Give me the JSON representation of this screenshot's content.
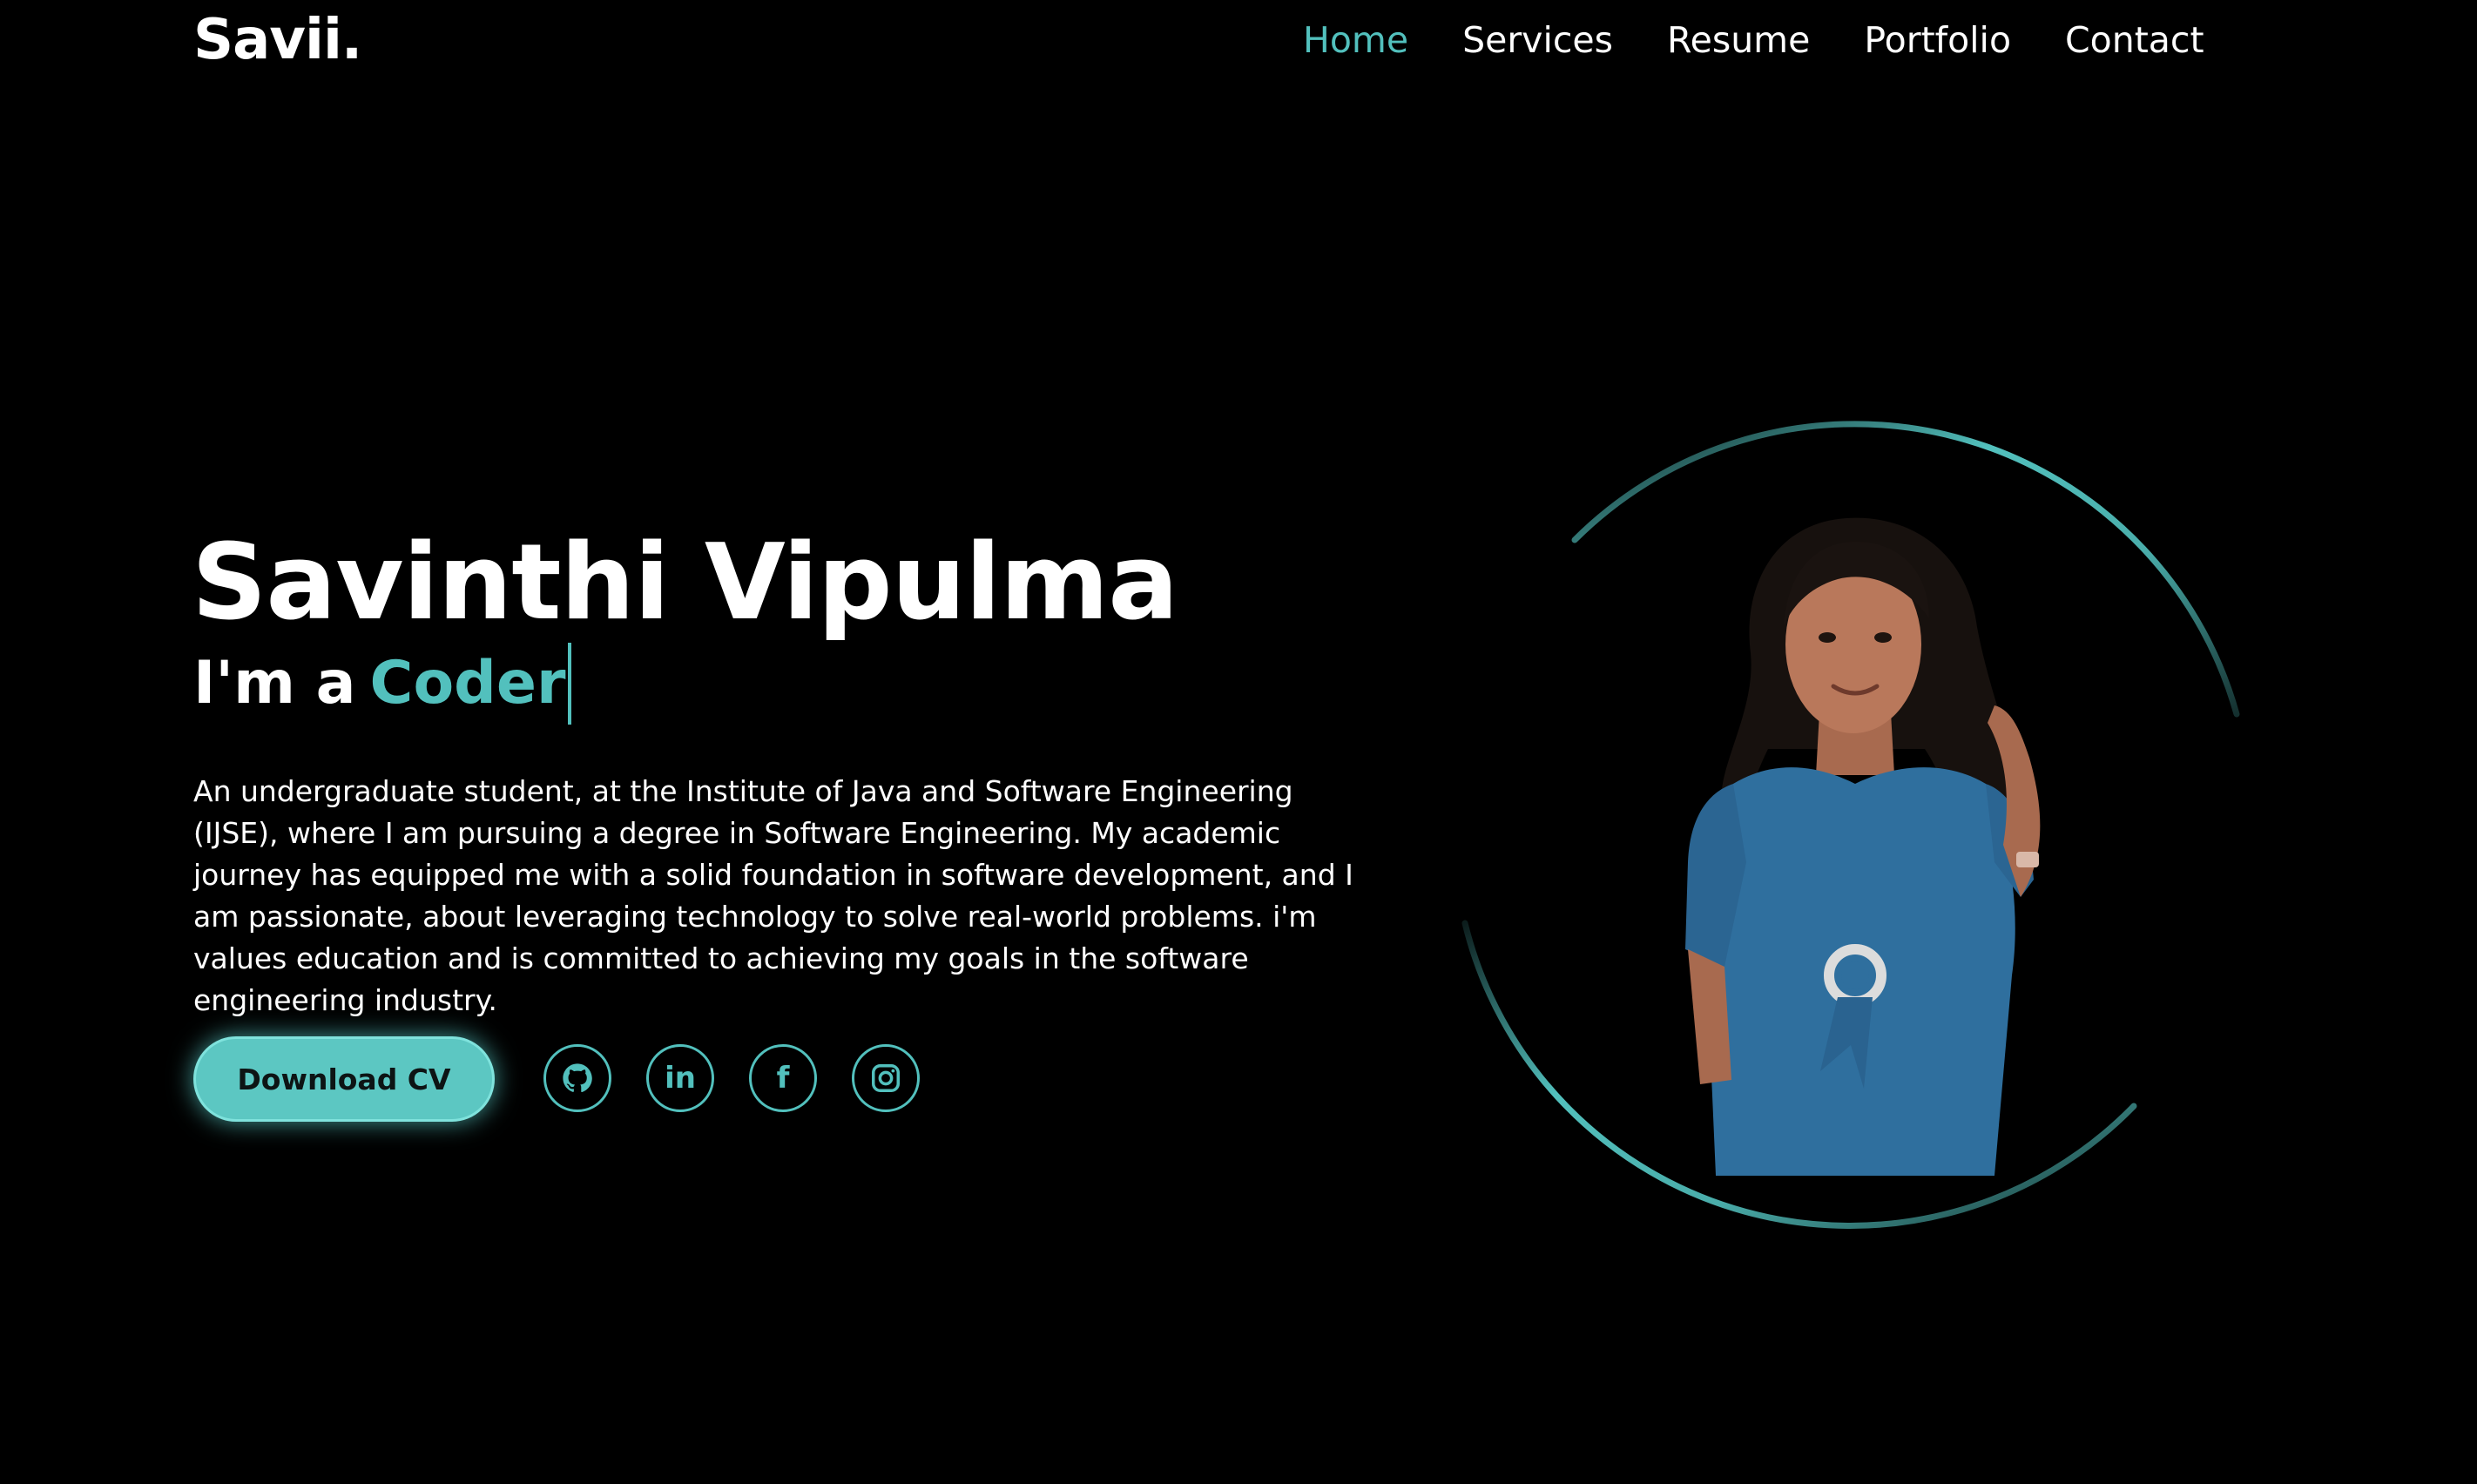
{
  "brand": {
    "logo": "Savii."
  },
  "nav": {
    "items": [
      {
        "label": "Home",
        "active": true
      },
      {
        "label": "Services",
        "active": false
      },
      {
        "label": "Resume",
        "active": false
      },
      {
        "label": "Portfolio",
        "active": false
      },
      {
        "label": "Contact",
        "active": false
      }
    ]
  },
  "hero": {
    "name": "Savinthi Vipulma",
    "role_prefix": "I'm a",
    "role_typed": "Coder",
    "description": "An undergraduate student, at the Institute of Java and Software Engineering (IJSE), where I am pursuing a degree in Software Engineering. My academic journey has equipped me with a solid foundation in software development, and I am passionate, about leveraging technology to solve real-world problems. i'm values education and is committed to achieving my goals in the software engineering industry.",
    "cv_button": "Download CV"
  },
  "socials": [
    {
      "icon": "github-icon"
    },
    {
      "icon": "linkedin-icon",
      "glyph": "in"
    },
    {
      "icon": "facebook-icon",
      "glyph": "f"
    },
    {
      "icon": "instagram-icon"
    }
  ],
  "colors": {
    "accent": "#52c0bd",
    "background": "#000000",
    "text": "#ffffff",
    "dress": "#2f6f9e"
  }
}
